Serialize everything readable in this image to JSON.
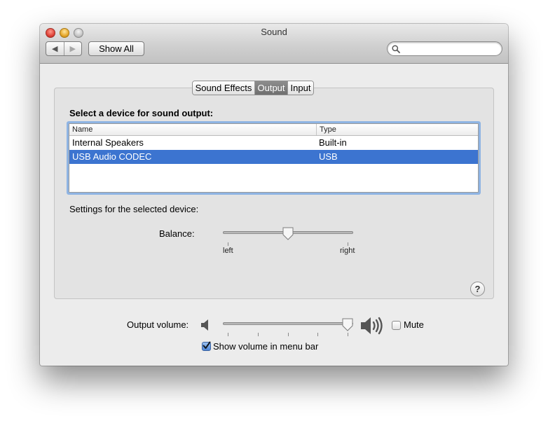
{
  "window": {
    "title": "Sound"
  },
  "toolbar": {
    "back_icon": "◀",
    "forward_icon": "▶",
    "show_all_label": "Show All",
    "search_placeholder": ""
  },
  "tabs": [
    {
      "label": "Sound Effects",
      "active": false
    },
    {
      "label": "Output",
      "active": true
    },
    {
      "label": "Input",
      "active": false
    }
  ],
  "output": {
    "device_heading": "Select a device for sound output:",
    "columns": {
      "name": "Name",
      "type": "Type"
    },
    "devices": [
      {
        "name": "Internal Speakers",
        "type": "Built-in",
        "selected": false
      },
      {
        "name": "USB Audio CODEC",
        "type": "USB",
        "selected": true
      }
    ],
    "settings_label": "Settings for the selected device:",
    "balance": {
      "label": "Balance:",
      "left_label": "left",
      "right_label": "right",
      "value": 0.5
    },
    "help_label": "?"
  },
  "volume": {
    "label": "Output volume:",
    "level": 0.98,
    "mute_label": "Mute",
    "mute_checked": false,
    "show_in_menu_bar_label": "Show volume in menu bar",
    "show_in_menu_bar_checked": true
  },
  "colors": {
    "selection": "#3c74d0",
    "focus_ring": "#8fb4e3"
  }
}
